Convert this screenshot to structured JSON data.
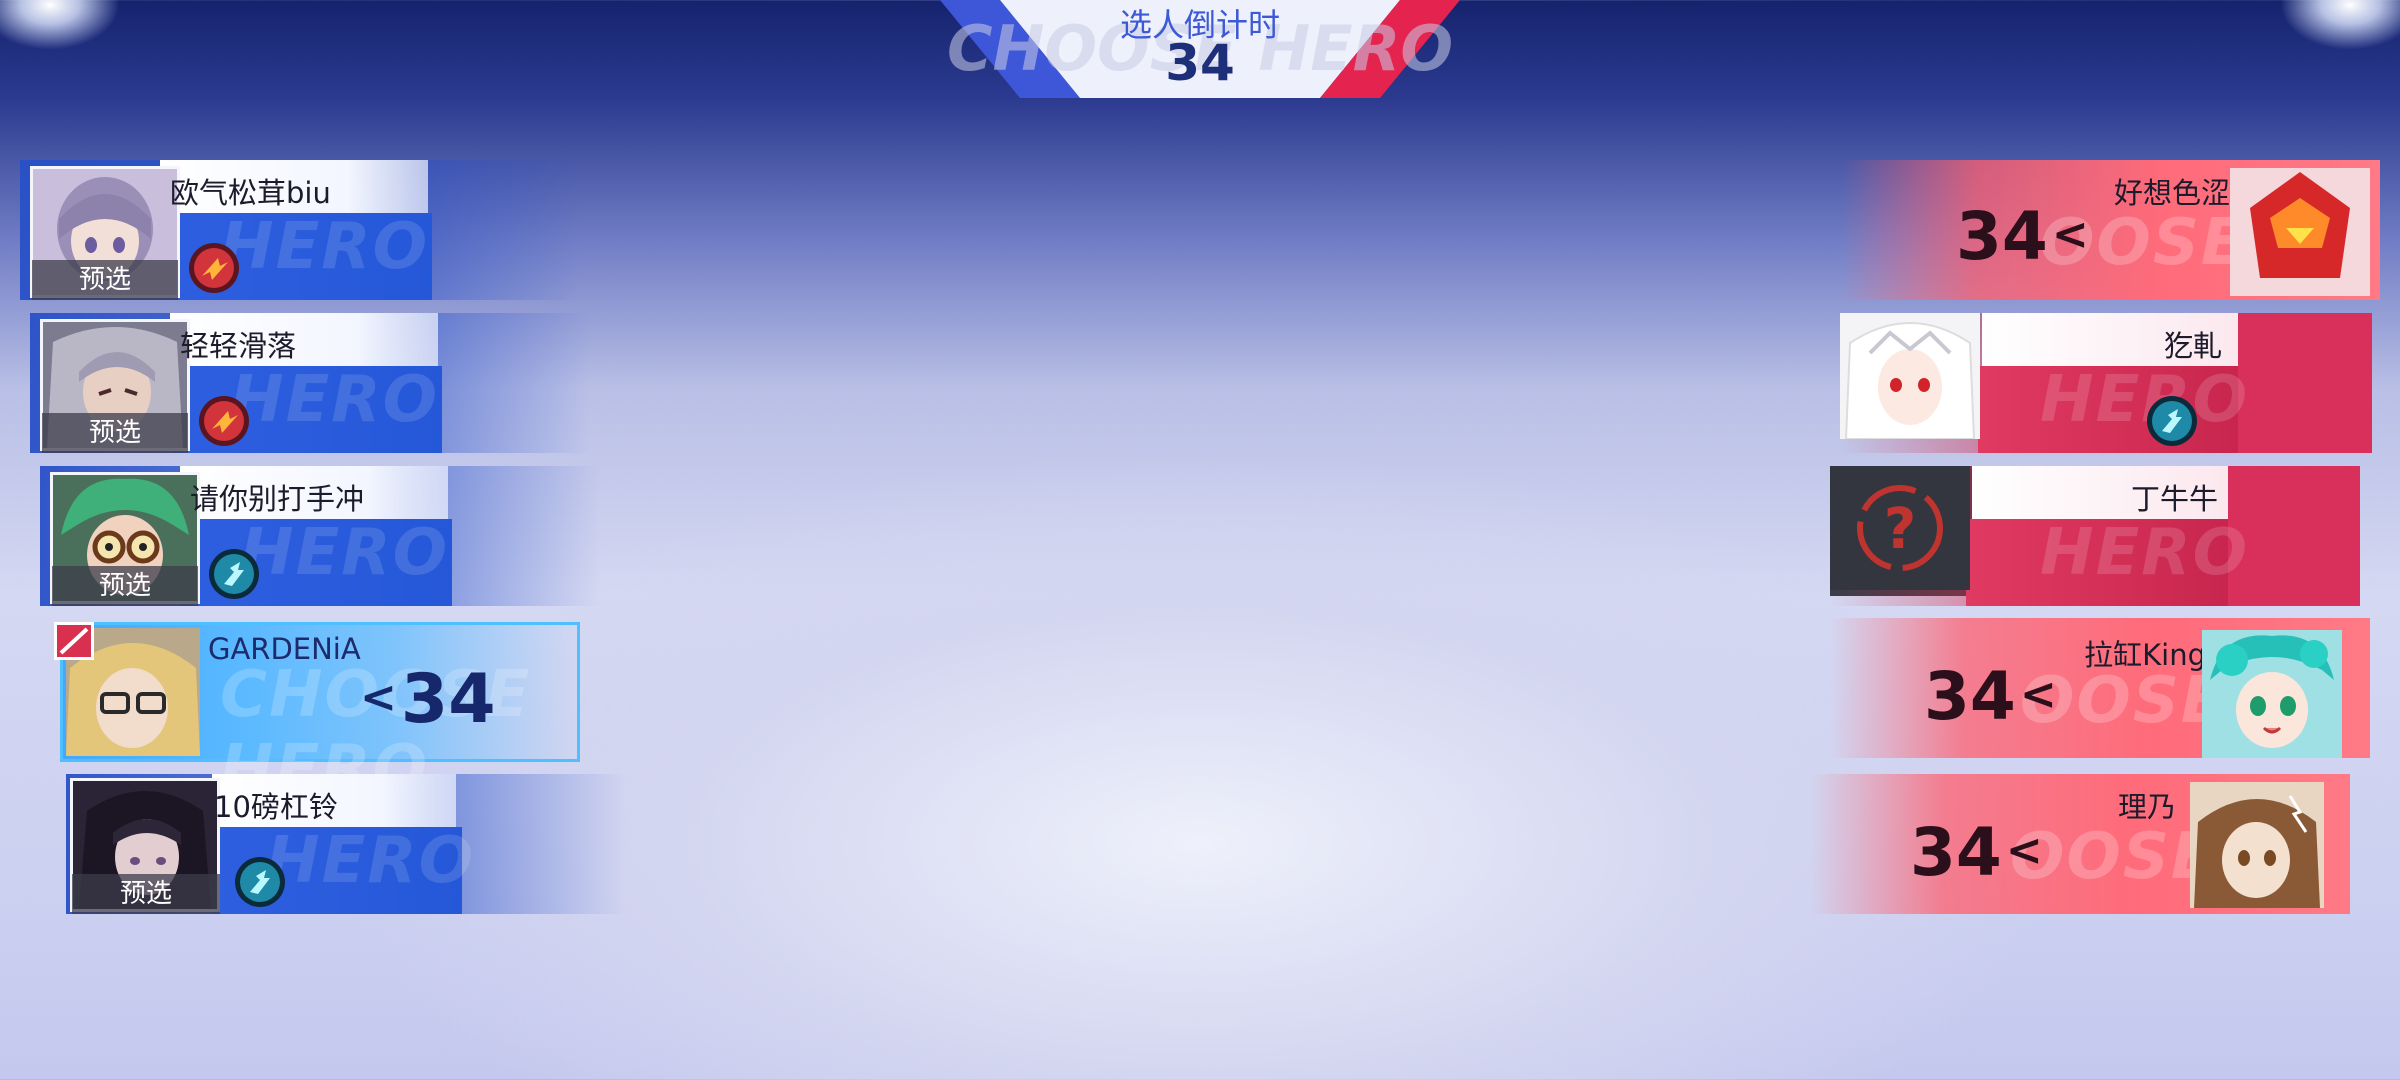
{
  "timer": {
    "label": "选人倒计时",
    "seconds": "34"
  },
  "left_team": [
    {
      "name": "欧气松茸biu",
      "preselect": "预选",
      "skill": "red-dash-skill-icon"
    },
    {
      "name": "轻轻滑落",
      "preselect": "预选",
      "skill": "red-dash-skill-icon"
    },
    {
      "name": "请你别打手冲",
      "preselect": "预选",
      "skill": "teal-sprint-skill-icon"
    },
    {
      "name": "GARDENiA",
      "countdown": "34",
      "arrow": "<"
    },
    {
      "name": "10磅杠铃",
      "preselect": "预选",
      "skill": "teal-sprint-skill-icon"
    }
  ],
  "right_team": [
    {
      "name": "好想色涩",
      "countdown": "34",
      "arrow": "<"
    },
    {
      "name": "犵軋",
      "skill": "teal-sprint-skill-icon"
    },
    {
      "name": "丁牛牛",
      "portrait": "question-mark-icon"
    },
    {
      "name": "拉缸King",
      "countdown": "34",
      "arrow": "<"
    },
    {
      "name": "理乃",
      "countdown": "34",
      "arrow": "<"
    }
  ],
  "watermark": {
    "hero": "HERO",
    "choose": "CHOOSE HERO",
    "ose": "OOSE"
  },
  "colors": {
    "blue_team": "#2e5fe0",
    "red_team": "#e13a62",
    "active_blue": "#4fc0ff",
    "active_red": "#ff6b7a"
  }
}
